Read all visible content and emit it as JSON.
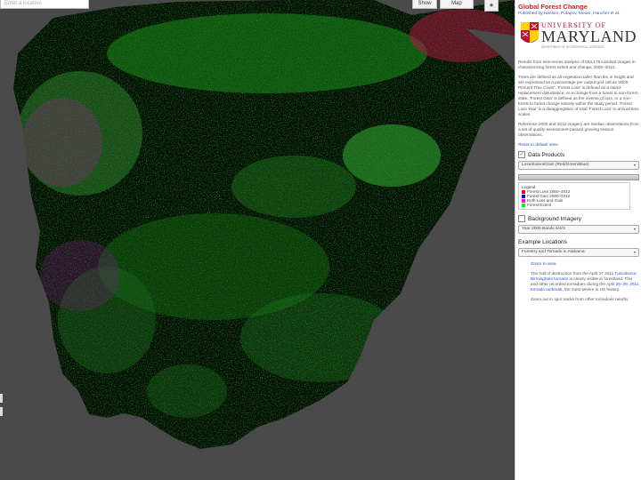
{
  "search": {
    "placeholder": "Enter a location"
  },
  "map_controls": {
    "show_label": "Show",
    "map_label": "Map",
    "pegman_icon": "pegman-icon"
  },
  "panel": {
    "title": "Global Forest Change",
    "authors": "Published by Hansen, Potapov, Moore, Hancher et al.",
    "logo": {
      "university_of": "UNIVERSITY OF",
      "maryland": "MARYLAND",
      "subtitle": "DEPARTMENT OF GEOGRAPHICAL SCIENCES"
    },
    "para1": "Results from time-series analysis of 654,178 Landsat images in characterizing forest extent and change, 2000–2012.",
    "para2": "Trees are defined as all vegetation taller than 5m in height and are expressed as a percentage per output grid cell as '2000 Percent Tree Cover'. 'Forest Loss' is defined as a stand-replacement disturbance, or a change from a forest to non-forest state. 'Forest Gain' is defined as the inverse of loss, or a non-forest to forest change entirely within the study period. 'Forest Loss Year' is a disaggregation of total 'Forest Loss' to annual time scales.",
    "para3": "Reference 2000 and 2012 imagery are median observations from a set of quality assessment-passed growing season observations.",
    "reset_link": "Reset to default view",
    "data_products": {
      "label": "Data Products",
      "checked": true,
      "selected": "Loss/Extent/Gain (Red/Green/Blue)"
    },
    "legend": {
      "title": "Legend",
      "items": [
        {
          "label": "Forest Loss 2000–2012",
          "color": "#ff0000"
        },
        {
          "label": "Forest Gain 2000–2012",
          "color": "#0000ff"
        },
        {
          "label": "Both Loss and Gain",
          "color": "#ff00ff"
        },
        {
          "label": "Forest Extent",
          "color": "#00ff00"
        }
      ]
    },
    "background": {
      "label": "Background Imagery",
      "checked": false,
      "selected": "Year 2000 Bands 5/4/3"
    },
    "examples": {
      "label": "Example Locations",
      "selected": "Forestry and Tornado in Alabama",
      "zoom_link": "Zoom to area",
      "desc_start": "The trail of destruction from the April 27 2011",
      "desc_link1": "Tuscaloosa-Birmingham tornado",
      "desc_mid": "is clearly visible in",
      "desc_mid2": "forestland. This and other recorded tornadoes",
      "desc_mid3": "during the",
      "desc_link2": "April 25–28, 2011 tornado outbreak",
      "desc_end": ", the most severe in US history.",
      "zoom_tracks": "Zoom out to spot tracks from other tornadoes nearby"
    }
  }
}
